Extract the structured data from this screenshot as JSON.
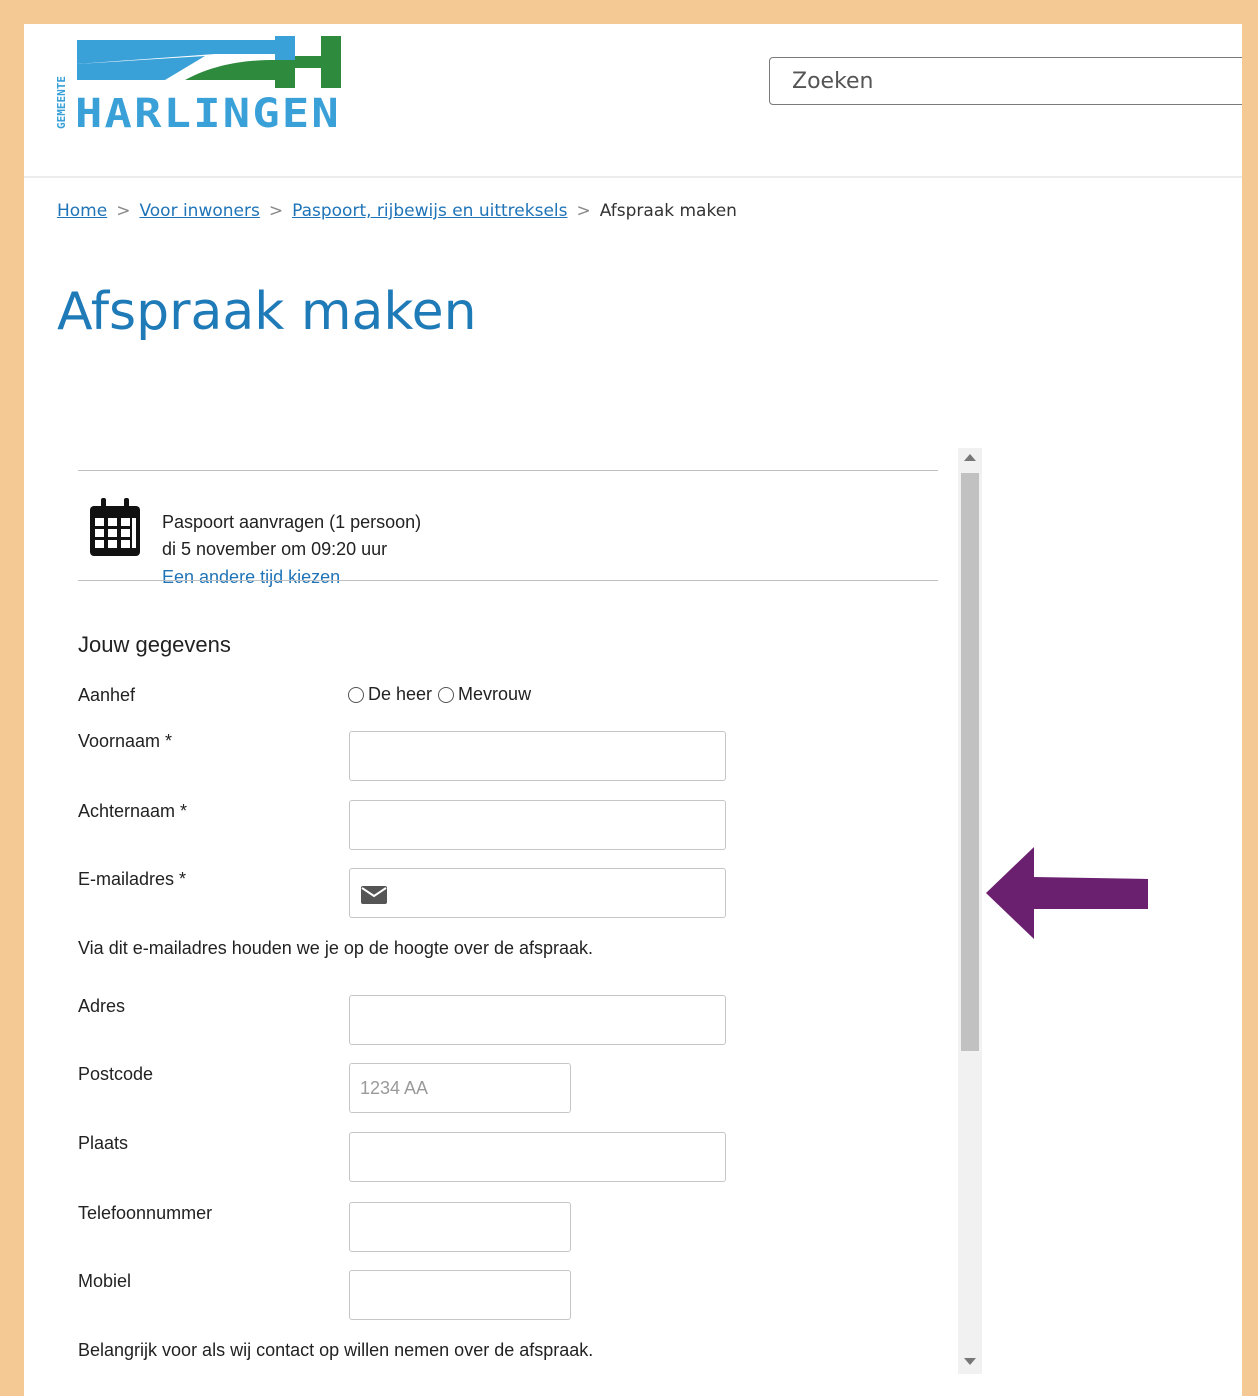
{
  "header": {
    "logo_small_text": "GEMEENTE",
    "logo_name": "HARLINGEN",
    "search_placeholder": "Zoeken"
  },
  "breadcrumb": {
    "items": [
      "Home",
      "Voor inwoners",
      "Paspoort, rijbewijs en uittreksels"
    ],
    "current": "Afspraak maken",
    "separator": ">"
  },
  "page_title": "Afspraak maken",
  "appointment": {
    "icon": "calendar-icon",
    "product": "Paspoort aanvragen (1 persoon)",
    "datetime": "di 5 november om 09:20 uur",
    "change_link": "Een andere tijd kiezen"
  },
  "form": {
    "section_title": "Jouw gegevens",
    "salutation_label": "Aanhef",
    "salutation_options": [
      "De heer",
      "Mevrouw"
    ],
    "firstname_label": "Voornaam *",
    "lastname_label": "Achternaam *",
    "email_label": "E-mailadres *",
    "email_icon": "envelope-icon",
    "email_note": "Via dit e-mailadres houden we je op de hoogte over de afspraak.",
    "address_label": "Adres",
    "postcode_label": "Postcode",
    "postcode_placeholder": "1234 AA",
    "city_label": "Plaats",
    "phone_label": "Telefoonnummer",
    "mobile_label": "Mobiel",
    "phone_note": "Belangrijk voor als wij contact op willen nemen over de afspraak."
  },
  "colors": {
    "frame_border": "#f5c994",
    "title": "#1f7ab8",
    "link": "#1f74b8",
    "logo_blue": "#3aa0d8",
    "logo_green": "#2e8b3e",
    "arrow": "#6a1f6f"
  }
}
